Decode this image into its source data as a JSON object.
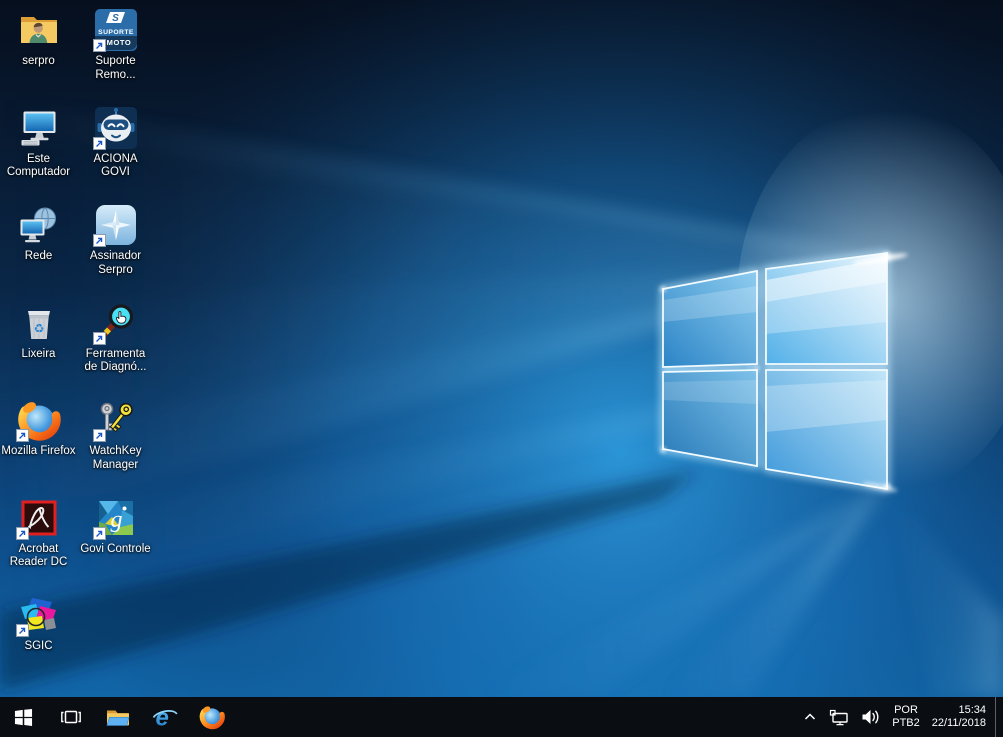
{
  "desktop": {
    "wallpaper": {
      "description": "Windows 10 hero wallpaper",
      "base_color": "#081a30",
      "accent_color": "#2f9fe0"
    },
    "icons": [
      {
        "name": "serpro",
        "label": "serpro",
        "shortcut": false
      },
      {
        "name": "este-computador",
        "label": "Este Computador",
        "shortcut": false
      },
      {
        "name": "rede",
        "label": "Rede",
        "shortcut": false
      },
      {
        "name": "lixeira",
        "label": "Lixeira",
        "shortcut": false
      },
      {
        "name": "mozilla-firefox",
        "label": "Mozilla Firefox",
        "shortcut": true
      },
      {
        "name": "acrobat-reader-dc",
        "label": "Acrobat Reader DC",
        "shortcut": true
      },
      {
        "name": "sgic",
        "label": "SGIC",
        "shortcut": true
      },
      {
        "name": "suporte-remoto",
        "label": "Suporte Remo...",
        "shortcut": true,
        "tile_top": "SUPORTE",
        "tile_bottom": "MOTO"
      },
      {
        "name": "aciona-govi",
        "label": "ACIONA GOVI",
        "shortcut": true
      },
      {
        "name": "assinador-serpro",
        "label": "Assinador Serpro",
        "shortcut": true
      },
      {
        "name": "ferramenta-diagnostico",
        "label": "Ferramenta de Diagnó...",
        "shortcut": true
      },
      {
        "name": "watchkey-manager",
        "label": "WatchKey Manager",
        "shortcut": true
      },
      {
        "name": "govi-controle",
        "label": "Govi Controle",
        "shortcut": true
      }
    ]
  },
  "taskbar": {
    "background_color": "#0a0d12",
    "buttons": [
      {
        "name": "start"
      },
      {
        "name": "task-view"
      },
      {
        "name": "file-explorer"
      },
      {
        "name": "internet-explorer"
      },
      {
        "name": "firefox"
      }
    ],
    "tray": {
      "icons": [
        "hidden-icons-chevron",
        "network",
        "volume"
      ],
      "language_top": "POR",
      "language_bottom": "PTB2",
      "time": "15:34",
      "date": "22/11/2018"
    }
  }
}
